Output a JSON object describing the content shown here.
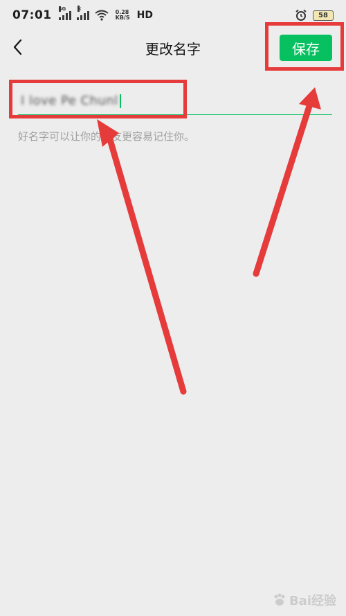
{
  "status_bar": {
    "time": "07:01",
    "signal1_label": "4G",
    "signal2_label": "×",
    "net_speed_value": "0.28",
    "net_speed_unit": "KB/S",
    "hd_label": "HD",
    "battery": "58"
  },
  "header": {
    "title": "更改名字",
    "save_label": "保存"
  },
  "name_input": {
    "value": "I love Pe Chunl"
  },
  "hint": "好名字可以让你的朋友更容易记住你。",
  "watermark": "Bai经验",
  "colors": {
    "accent": "#07c160",
    "annotation": "#e63b3b",
    "background": "#ededed"
  },
  "icons": {
    "back": "chevron-left-icon",
    "wifi": "wifi-icon",
    "alarm": "alarm-icon"
  }
}
